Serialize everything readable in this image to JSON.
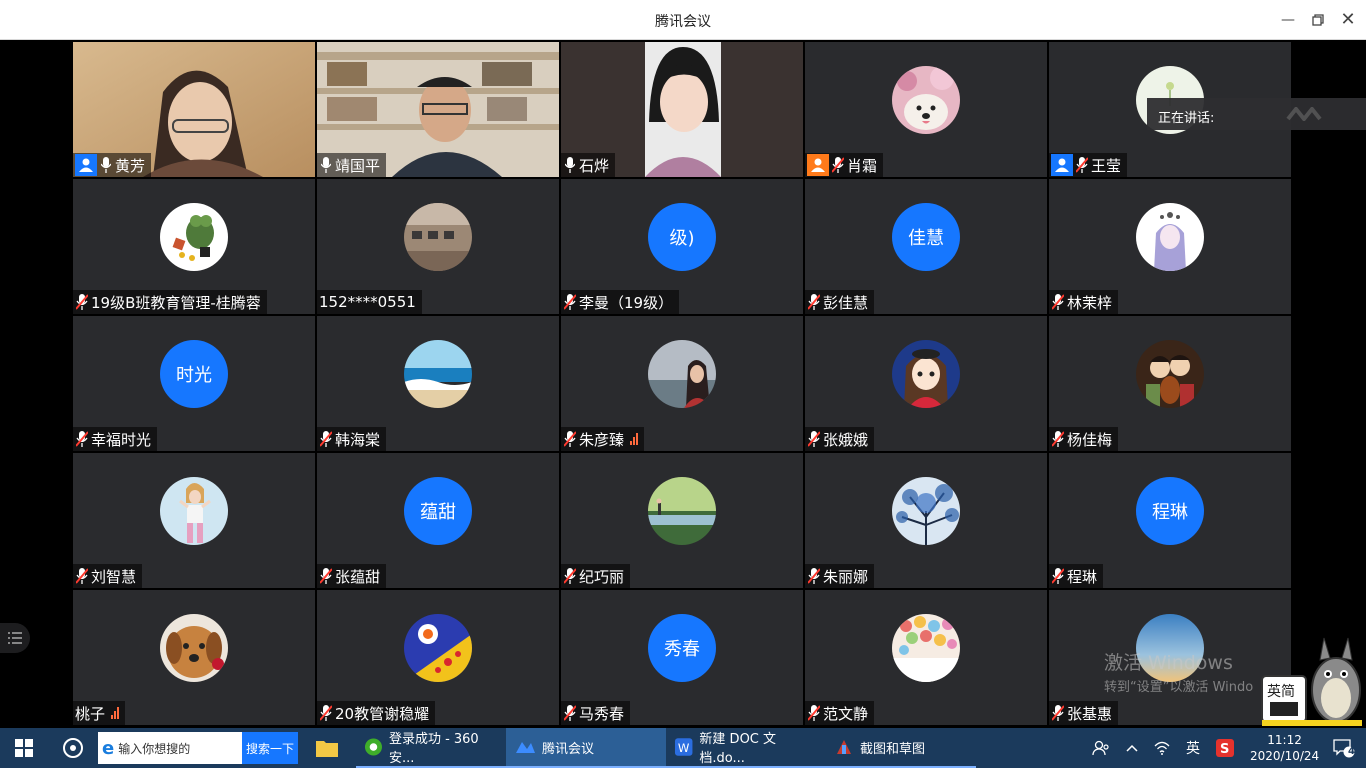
{
  "window": {
    "title": "腾讯会议"
  },
  "speaking": {
    "label": "正在讲话:"
  },
  "participants": [
    {
      "name": "黄芳",
      "mic": "on",
      "host": true,
      "hostColor": "#1677ff",
      "video": "huangfang"
    },
    {
      "name": "靖国平",
      "mic": "on",
      "video": "jingguoping"
    },
    {
      "name": "石烨",
      "mic": "on",
      "video": "shiye"
    },
    {
      "name": "肖霜",
      "mic": "off",
      "host": true,
      "hostColor": "#ff7a1a",
      "avatar": "dog-photo"
    },
    {
      "name": "王莹",
      "mic": "off",
      "host": true,
      "hostColor": "#1677ff",
      "avatar": "flower-photo"
    },
    {
      "name": "19级B班教育管理-桂腾蓉",
      "mic": "off",
      "avatar": "frog-cartoon"
    },
    {
      "name": "152****0551",
      "mic": "none",
      "avatar": "room-photo"
    },
    {
      "name": "李曼（19级）",
      "mic": "off",
      "avatarText": "级)"
    },
    {
      "name": "彭佳慧",
      "mic": "off",
      "avatarText": "佳慧"
    },
    {
      "name": "林茉梓",
      "mic": "off",
      "avatar": "anime-girl"
    },
    {
      "name": "幸福时光",
      "mic": "off",
      "avatarText": "时光"
    },
    {
      "name": "韩海棠",
      "mic": "off",
      "avatar": "sea-photo"
    },
    {
      "name": "朱彦臻",
      "mic": "off",
      "signal": true,
      "avatar": "girl-lake"
    },
    {
      "name": "张娥娥",
      "mic": "off",
      "avatar": "cartoon-girl"
    },
    {
      "name": "杨佳梅",
      "mic": "off",
      "avatar": "violin-anime"
    },
    {
      "name": "刘智慧",
      "mic": "off",
      "avatar": "girl-pose"
    },
    {
      "name": "张蕴甜",
      "mic": "off",
      "avatarText": "蕴甜"
    },
    {
      "name": "纪巧丽",
      "mic": "off",
      "avatar": "lake-green"
    },
    {
      "name": "朱丽娜",
      "mic": "off",
      "avatar": "blue-tree"
    },
    {
      "name": "程琳",
      "mic": "off",
      "avatarText": "程琳"
    },
    {
      "name": "桃子",
      "mic": "none",
      "signal": true,
      "avatar": "dog-rose"
    },
    {
      "name": "20教管谢稳耀",
      "mic": "off",
      "avatar": "colorful-art"
    },
    {
      "name": "马秀春",
      "mic": "off",
      "avatarText": "秀春"
    },
    {
      "name": "范文静",
      "mic": "off",
      "avatar": "balloons"
    },
    {
      "name": "张基惠",
      "mic": "off",
      "avatar": "sunset-sky"
    }
  ],
  "watermark": {
    "line1": "激活 Windows",
    "line2": "转到“设置”以激活 Windo"
  },
  "taskbar": {
    "search_placeholder": "输入你想搜的",
    "search_button": "搜索一下",
    "apps": [
      {
        "label": "登录成功 - 360安..."
      },
      {
        "label": "腾讯会议"
      },
      {
        "label": "新建 DOC 文档.do..."
      },
      {
        "label": "截图和草图"
      }
    ],
    "ime": "英",
    "time": "11:12",
    "date": "2020/10/24",
    "notifications": "4"
  },
  "colors": {
    "tile": "#2a2b2e",
    "accent": "#1677ff",
    "taskbar": "#1b3a5c"
  }
}
